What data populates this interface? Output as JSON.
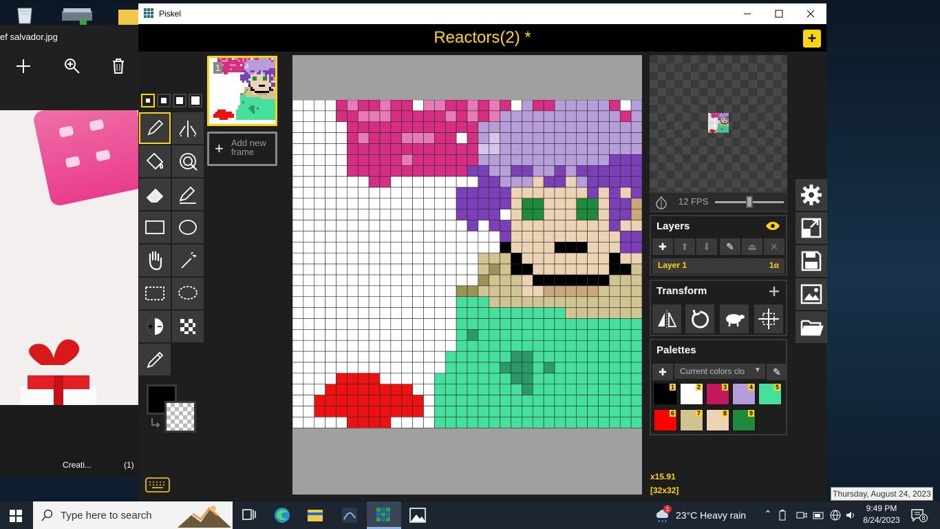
{
  "colors": {
    "accent": "#ffd700",
    "panel": "#3a3a3a",
    "background": "#1e1e1e"
  },
  "photo_viewer": {
    "title": "ef salvador.jpg",
    "status_left": "Creati...",
    "status_right": "(1)",
    "tools": [
      "add-icon",
      "zoom-in-icon",
      "delete-icon"
    ]
  },
  "window": {
    "app_title": "Piskel"
  },
  "header": {
    "document_title": "Reactors(2) *",
    "new_button": "+"
  },
  "frames": {
    "frame_number": "1",
    "add_frame_label": "Add new frame"
  },
  "canvas": {
    "palette": {
      "w": "#ffffff",
      "h": "#d62e82",
      "p": "#e87ab5",
      "l": "#b89ed8",
      "L": "#d5c6ec",
      "v": "#7b3fb8",
      "s": "#ecd3b3",
      "t": "#c9a97a",
      "g": "#1e8a3c",
      "G": "#2eaa58",
      "k": "#000000",
      "o": "#cfc492",
      "O": "#9c9254",
      "m": "#45e09c",
      "M": "#2a9a6a",
      "r": "#ee1111"
    },
    "rows": [
      "wwwwhphhphhwpphhphphwlhhlllllhwl",
      "wwwwhhppphhhhhphphplllllllllllhl",
      "wwwwwhhhhhhhhhhhhlllllllllllllll",
      "wwwwwhphhhppphhwhlLlllllllllllll",
      "wwwwwhhhhhhhhhhhhLLllllllllllllll",
      "wwwwwhhhhhphhhhhhllllllllllllvvvl",
      "wwwwwhhhhhhhhhhhvvllvvllvlvvvvvv",
      "wwwwwwwhhwwwwwwwwvvlllsvvslvvvvv",
      "wwwwwwwwwwwwwwwvvvvvsssssssvsvsv",
      "wwwwwwwwwwwwwwwvvvvvsggsssggsvvt",
      "wwwwwwwwwwwwwwwvvvvwsggsssggsvvt",
      "wwwwwwwwwwwwwwwwvwvvsssssssssvss",
      "wwwwwwwwwwwwwwwwwwwvssssssssssvv",
      "wwwwwwwwwwwwwwwwwwwksssskkksssvv",
      "wwwwwwwwwwwwwwwwwoooksssssssskss",
      "wwwwwwwwwwwwwwwwwoOokkssssssskko",
      "wwwwwwwwwwwwwwwwwOoooskkkkkkkooo",
      "wwwwwwwwwwwwwwwOOoooosstttttoooo",
      "wwwwwwwwwwwwwwwmmmooooooooooooo",
      "wwwwwwwwwwwwwwwmmmmmmmmmmoooooo",
      "wwwwwwwwwwwwwwwmmmmmmmmmmmmmmmm",
      "wwwwwwwwwwwwwwwmMmmmmmmmmmmmmmm",
      "wwwwwwwwwwwwwwwmmmmmmmmmmmmmmmm",
      "wwwwwwwwwwwwwwmmmmmmMMmmmmmmmmmm",
      "wwwwwwwwwwwwwwmmmmmMMMmMmmmmmmmm",
      "wwwwrrrrwwwwwmmmmmmmMMmmmmmmmmmm",
      "wwwrrrrrrrrwwmmmmmmmmMmmmmmmmmmm",
      "wwrrrrrrrrrrwmmmmmmmmmmmmmmmmmmm",
      "wwrrrrrrrrrrwmmmmmmmmmmmmmmmmmmm",
      "wwwwwrrrrwwwwmmmmmmmmmmmmmmmmmmm"
    ]
  },
  "preview": {
    "fps_label": "12 FPS",
    "fps_value": 12
  },
  "layers": {
    "title": "Layers",
    "layer_name": "Layer 1",
    "layer_alpha": "1α"
  },
  "transform": {
    "title": "Transform"
  },
  "palettes": {
    "title": "Palettes",
    "selected": "Current colors clo",
    "swatches": [
      {
        "n": "1",
        "color": "#000000"
      },
      {
        "n": "2",
        "color": "#ffffff"
      },
      {
        "n": "3",
        "color": "#c2185b"
      },
      {
        "n": "4",
        "color": "#b39ddb"
      },
      {
        "n": "5",
        "color": "#45e09c"
      },
      {
        "n": "6",
        "color": "#ff0000"
      },
      {
        "n": "7",
        "color": "#cfc492"
      },
      {
        "n": "8",
        "color": "#ecd3b3"
      },
      {
        "n": "9",
        "color": "#1e8a3c"
      }
    ]
  },
  "status": {
    "zoom": "x15.91",
    "size": "[32x32]"
  },
  "taskbar": {
    "search_placeholder": "Type here to search",
    "weather": "23°C  Heavy rain",
    "time": "9:49 PM",
    "date": "8/24/2023",
    "tooltip": "Thursday, August 24, 2023",
    "notifications": "8",
    "weather_badge": "1"
  }
}
